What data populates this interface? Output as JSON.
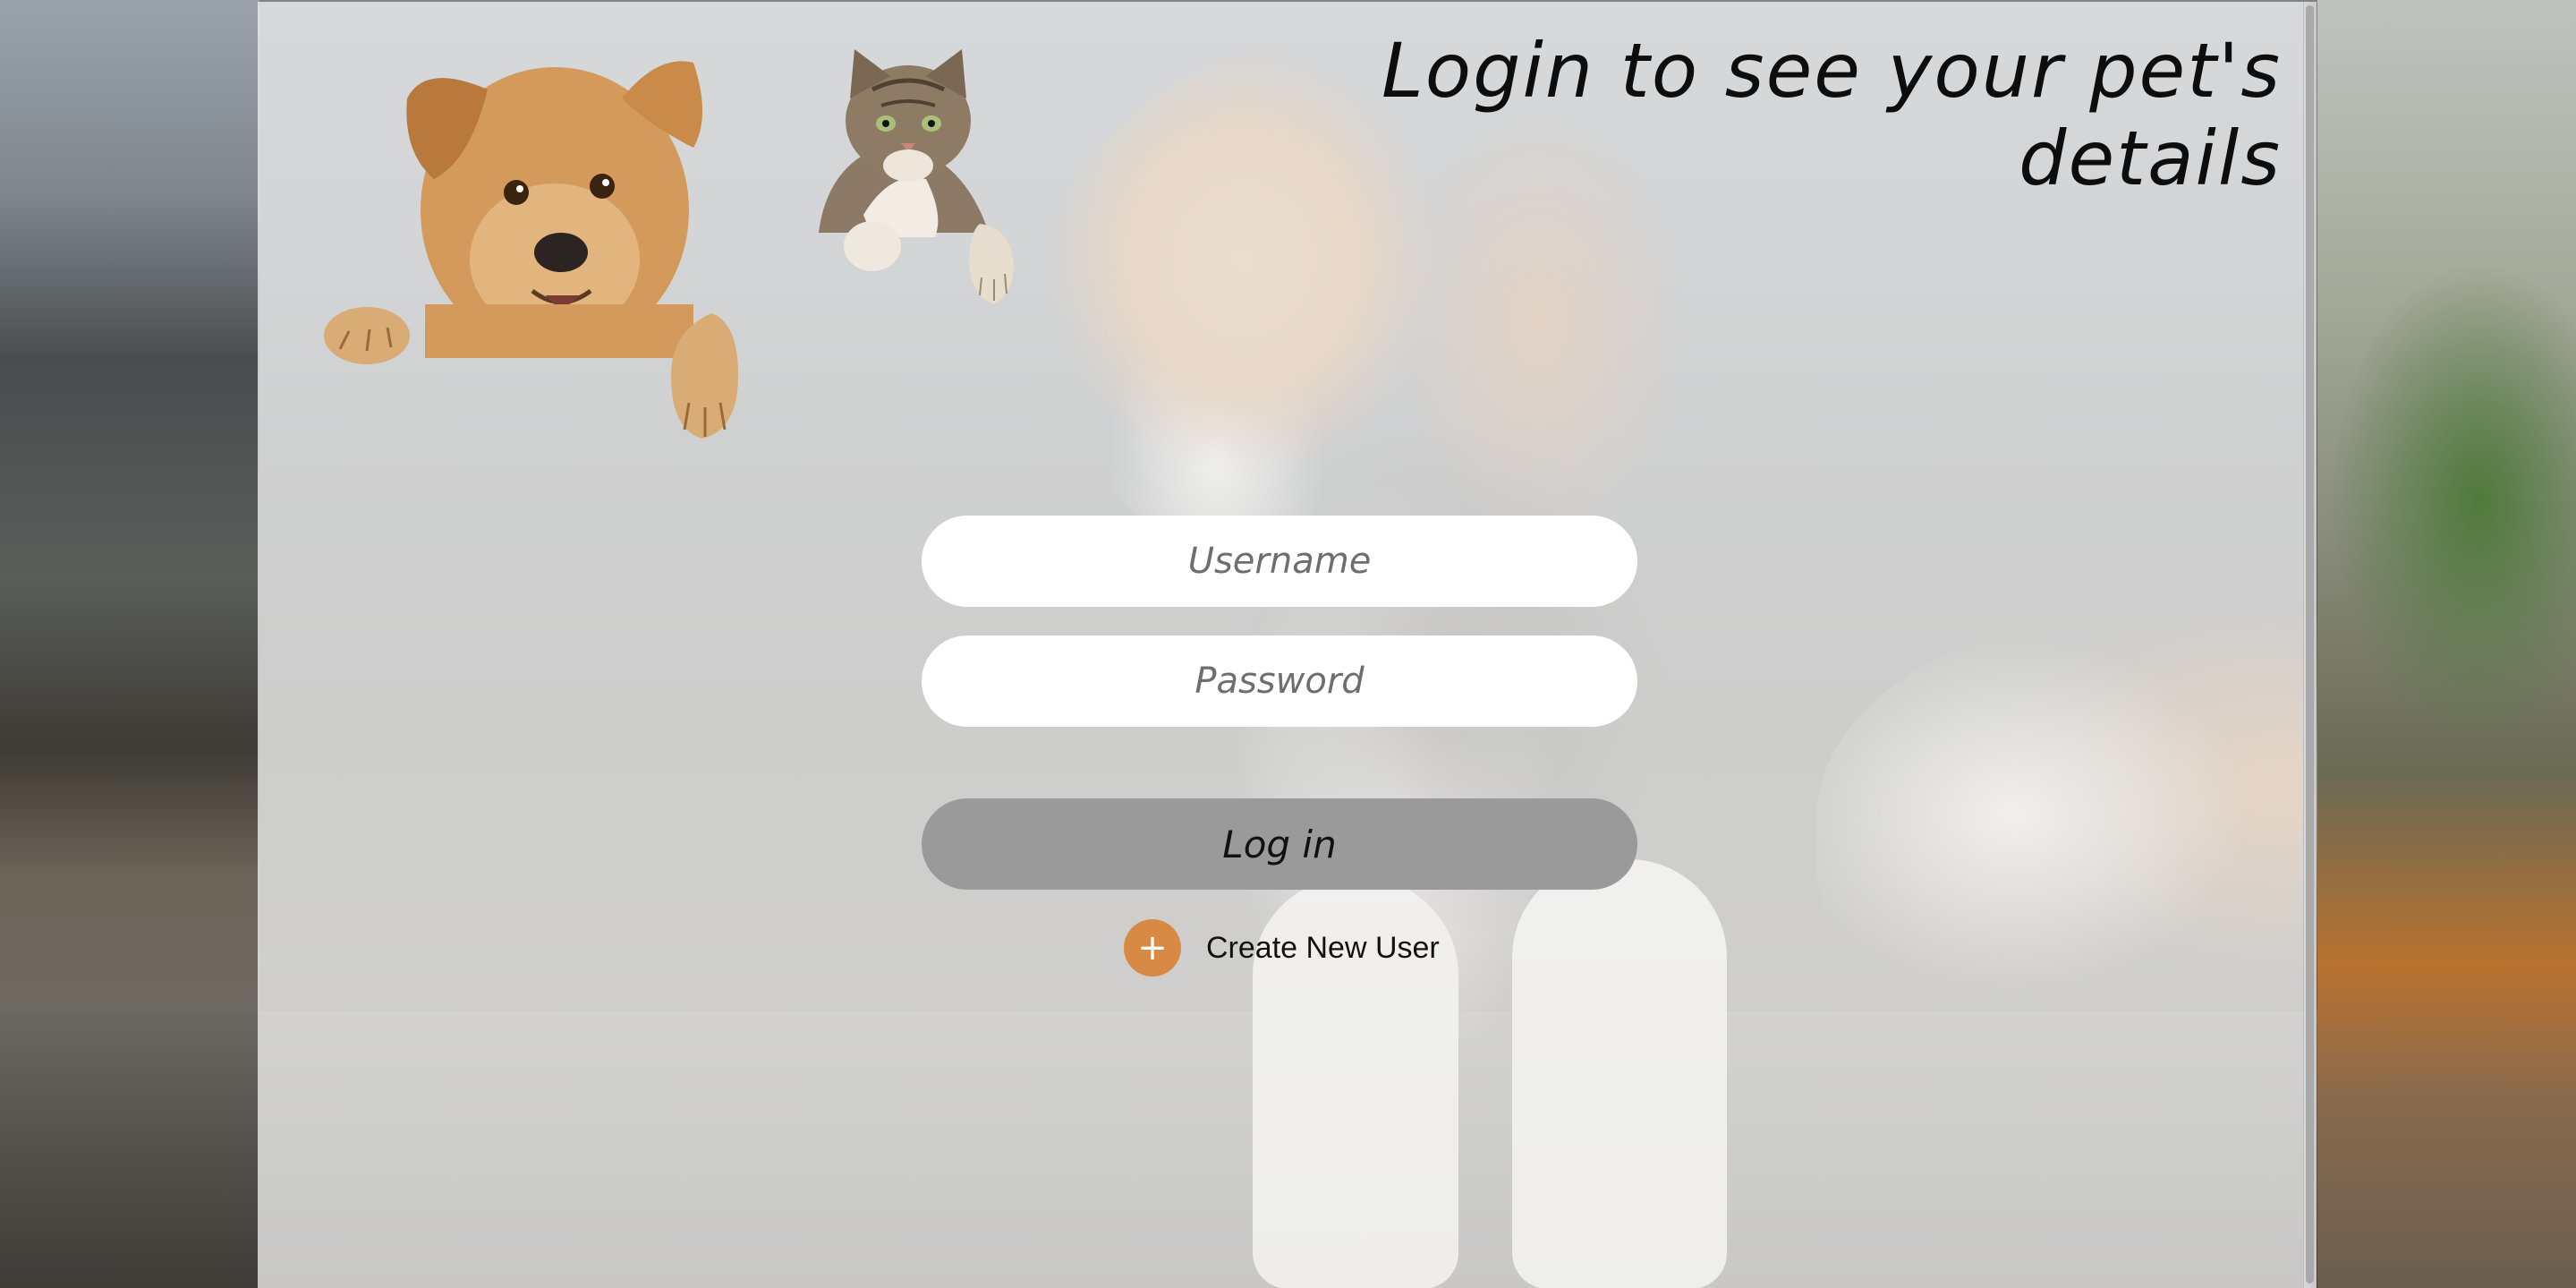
{
  "page": {
    "title": "Login to see your pet's details"
  },
  "illustration": {
    "left_animal": "dog-icon",
    "right_animal": "cat-icon"
  },
  "login_form": {
    "username_placeholder": "Username",
    "password_placeholder": "Password",
    "login_label": "Log in"
  },
  "create_user": {
    "icon": "plus-icon",
    "icon_glyph": "+",
    "label": "Create New User"
  },
  "colors": {
    "accent": "#d88a45",
    "login_button": "#9a9a9a",
    "panel_overlay": "#f0f0f0"
  }
}
